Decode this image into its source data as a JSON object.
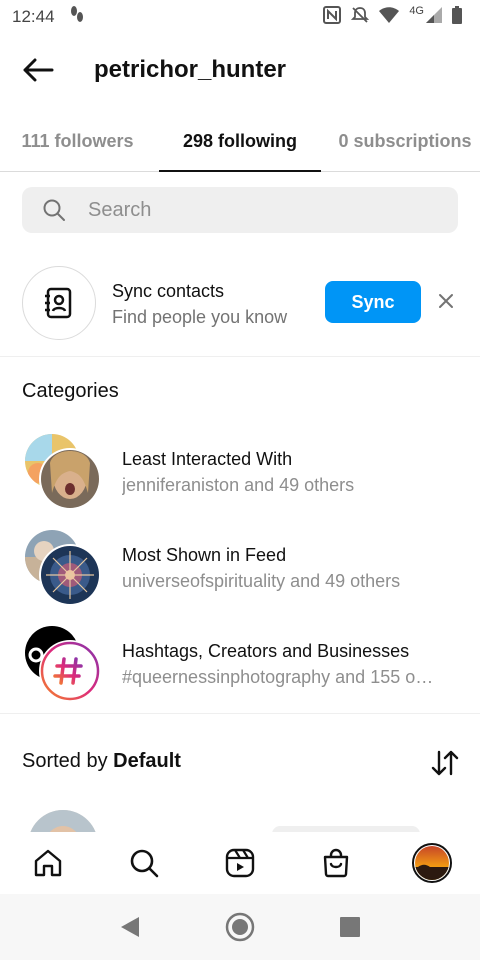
{
  "status_bar": {
    "time": "12:44",
    "network": "4G"
  },
  "header": {
    "title": "petrichor_hunter"
  },
  "tabs": [
    {
      "label": "111 followers",
      "active": false
    },
    {
      "label": "298 following",
      "active": true
    },
    {
      "label": "0 subscriptions",
      "active": false
    }
  ],
  "search": {
    "placeholder": "Search"
  },
  "sync": {
    "title": "Sync contacts",
    "subtitle": "Find people you know",
    "button_label": "Sync"
  },
  "categories": {
    "heading": "Categories",
    "items": [
      {
        "name": "Least Interacted With",
        "subtitle": "jenniferaniston and 49 others"
      },
      {
        "name": "Most Shown in Feed",
        "subtitle": "universeofspirituality and 49 others"
      },
      {
        "name": "Hashtags, Creators and Businesses",
        "subtitle": "#queernessinphotography and 155 o…"
      }
    ]
  },
  "sort": {
    "prefix": "Sorted by",
    "value": "Default"
  },
  "colors": {
    "accent": "#0095f6",
    "muted": "#8e8e8e"
  },
  "icons": {
    "back": "arrow-left-icon",
    "search": "search-icon",
    "contacts": "contact-book-icon",
    "close": "close-icon",
    "sort": "sort-arrows-icon",
    "nav": [
      "home-icon",
      "search-icon",
      "reels-icon",
      "shop-icon",
      "profile-avatar"
    ]
  }
}
